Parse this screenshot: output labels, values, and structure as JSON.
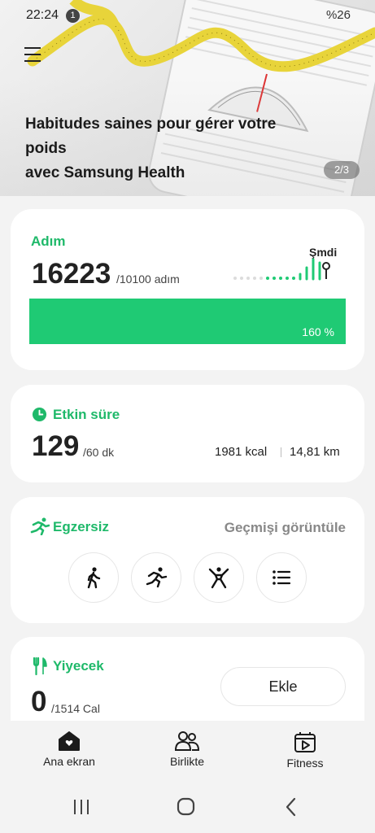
{
  "status_bar": {
    "time": "22:24",
    "notification_count": "1",
    "right_text": "%26"
  },
  "hero": {
    "title": "Habitudes saines pour gérer votre\npoids\navec Samsung Health",
    "page_indicator": "2/3"
  },
  "steps": {
    "title": "Adım",
    "value": "16223",
    "goal": "/10100 adım",
    "now_label": "Şmdi",
    "progress_label": "160 %",
    "progress": 1.0
  },
  "active_time": {
    "title": "Etkin süre",
    "value": "129",
    "goal": "/60 dk",
    "calories": "1981 kcal",
    "distance": "14,81 km"
  },
  "exercise": {
    "title": "Egzersiz",
    "history_link": "Geçmişi görüntüle",
    "buttons": [
      "walk-icon",
      "run-icon",
      "workout-icon",
      "list-icon"
    ]
  },
  "food": {
    "title": "Yiyecek",
    "value": "0",
    "goal": "/1514 Cal",
    "add_label": "Ekle"
  },
  "bottom_nav": {
    "items": [
      {
        "label": "Ana ekran",
        "icon": "home-icon"
      },
      {
        "label": "Birlikte",
        "icon": "people-icon"
      },
      {
        "label": "Fitness",
        "icon": "fitness-icon"
      }
    ]
  },
  "colors": {
    "accent": "#1fb96a",
    "progress": "#1fca74"
  }
}
